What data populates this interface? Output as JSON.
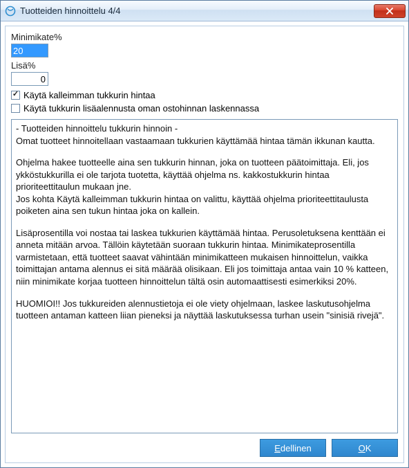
{
  "window": {
    "title": "Tuotteiden hinnoittelu 4/4"
  },
  "fields": {
    "minimikate_label": "Minimikate%",
    "minimikate_value": "20",
    "lisa_label": "Lisä%",
    "lisa_value": "0"
  },
  "checkboxes": {
    "kalleimman": {
      "label": "Käytä kalleimman tukkurin hintaa",
      "checked": true
    },
    "lisaalennusta": {
      "label": "Käytä tukkurin lisäalennusta oman ostohinnan laskennassa",
      "checked": false
    }
  },
  "info": {
    "l1": "- Tuotteiden hinnoittelu tukkurin hinnoin -",
    "l2": "Omat tuotteet hinnoitellaan vastaamaan tukkurien käyttämää hintaa tämän ikkunan kautta.",
    "l3": "Ohjelma hakee tuotteelle aina sen tukkurin hinnan, joka on tuotteen päätoimittaja. Eli, jos ykköstukkurilla ei ole tarjota tuotetta, käyttää ohjelma ns. kakkostukkurin hintaa prioriteettitaulun mukaan jne.",
    "l4": "Jos kohta Käytä kalleimman tukkurin hintaa on valittu, käyttää ohjelma prioriteettitaulusta poiketen aina sen tukun hintaa joka on kallein.",
    "l5": "Lisäprosentilla voi nostaa tai laskea tukkurien käyttämää hintaa. Perusoletuksena kenttään ei anneta mitään arvoa. Tällöin käytetään suoraan tukkurin hintaa. Minimikateprosentilla varmistetaan, että tuotteet saavat vähintään minimikatteen mukaisen hinnoittelun, vaikka toimittajan antama alennus ei sitä määrää olisikaan. Eli jos toimittaja antaa vain 10 % katteen, niin minimikate korjaa tuotteen hinnoittelun tältä osin automaattisesti esimerkiksi 20%.",
    "l6": "HUOMIOI!! Jos tukkureiden alennustietoja ei ole viety ohjelmaan, laskee laskutusohjelma tuotteen antaman katteen liian pieneksi ja näyttää laskutuksessa turhan usein \"sinisiä rivejä\"."
  },
  "buttons": {
    "prev_prefix": "E",
    "prev_rest": "dellinen",
    "ok_prefix": "O",
    "ok_rest": "K"
  }
}
